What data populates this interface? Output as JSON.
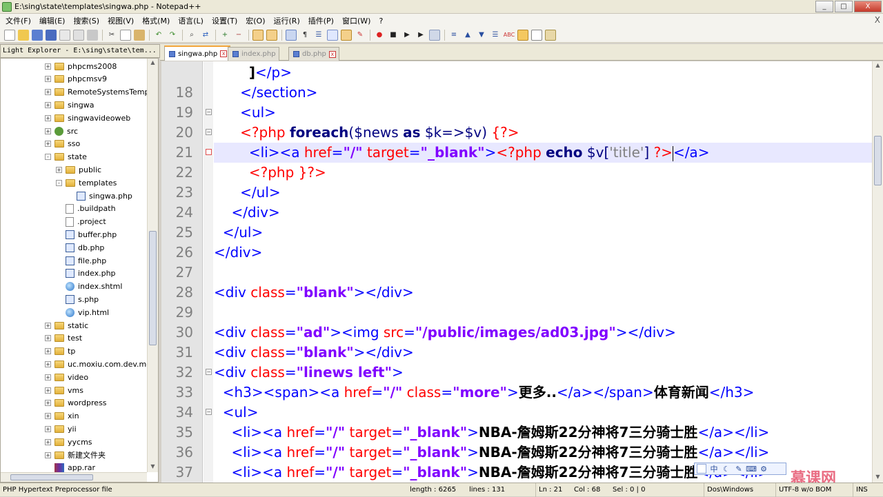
{
  "window": {
    "title": "E:\\sing\\state\\templates\\singwa.php - Notepad++",
    "btn_min": "_",
    "btn_max": "□",
    "btn_close": "X"
  },
  "menu": [
    "文件(F)",
    "编辑(E)",
    "搜索(S)",
    "视图(V)",
    "格式(M)",
    "语言(L)",
    "设置(T)",
    "宏(O)",
    "运行(R)",
    "插件(P)",
    "窗口(W)",
    "?"
  ],
  "menu_close": "X",
  "left_panel": {
    "title": "Light Explorer - E:\\sing\\state\\tem...",
    "tree": [
      {
        "label": "phpcms2008",
        "type": "folder",
        "indent": 0,
        "expander": "+"
      },
      {
        "label": "phpcmsv9",
        "type": "folder",
        "indent": 0,
        "expander": "+"
      },
      {
        "label": "RemoteSystemsTemp",
        "type": "folder",
        "indent": 0,
        "expander": "+"
      },
      {
        "label": "singwa",
        "type": "folder",
        "indent": 0,
        "expander": "+"
      },
      {
        "label": "singwavideoweb",
        "type": "folder",
        "indent": 0,
        "expander": "+"
      },
      {
        "label": "src",
        "type": "src",
        "indent": 0,
        "expander": "+"
      },
      {
        "label": "sso",
        "type": "folder",
        "indent": 0,
        "expander": "+"
      },
      {
        "label": "state",
        "type": "folder",
        "indent": 0,
        "expander": "-"
      },
      {
        "label": "public",
        "type": "folder",
        "indent": 1,
        "expander": "+"
      },
      {
        "label": "templates",
        "type": "folder",
        "indent": 1,
        "expander": "-"
      },
      {
        "label": "singwa.php",
        "type": "php",
        "indent": 2,
        "expander": ""
      },
      {
        "label": ".buildpath",
        "type": "file",
        "indent": 1,
        "expander": ""
      },
      {
        "label": ".project",
        "type": "file",
        "indent": 1,
        "expander": ""
      },
      {
        "label": "buffer.php",
        "type": "php",
        "indent": 1,
        "expander": ""
      },
      {
        "label": "db.php",
        "type": "php",
        "indent": 1,
        "expander": ""
      },
      {
        "label": "file.php",
        "type": "php",
        "indent": 1,
        "expander": ""
      },
      {
        "label": "index.php",
        "type": "php",
        "indent": 1,
        "expander": ""
      },
      {
        "label": "index.shtml",
        "type": "html",
        "indent": 1,
        "expander": ""
      },
      {
        "label": "s.php",
        "type": "php",
        "indent": 1,
        "expander": ""
      },
      {
        "label": "vip.html",
        "type": "html",
        "indent": 1,
        "expander": ""
      },
      {
        "label": "static",
        "type": "folder",
        "indent": 0,
        "expander": "+"
      },
      {
        "label": "test",
        "type": "folder",
        "indent": 0,
        "expander": "+"
      },
      {
        "label": "tp",
        "type": "folder",
        "indent": 0,
        "expander": "+"
      },
      {
        "label": "uc.moxiu.com.dev.mo",
        "type": "folder",
        "indent": 0,
        "expander": "+"
      },
      {
        "label": "video",
        "type": "folder",
        "indent": 0,
        "expander": "+"
      },
      {
        "label": "vms",
        "type": "folder",
        "indent": 0,
        "expander": "+"
      },
      {
        "label": "wordpress",
        "type": "folder",
        "indent": 0,
        "expander": "+"
      },
      {
        "label": "xin",
        "type": "folder",
        "indent": 0,
        "expander": "+"
      },
      {
        "label": "yii",
        "type": "folder",
        "indent": 0,
        "expander": "+"
      },
      {
        "label": "yycms",
        "type": "folder",
        "indent": 0,
        "expander": "+"
      },
      {
        "label": "新建文件夹",
        "type": "folder",
        "indent": 0,
        "expander": "+"
      },
      {
        "label": "app.rar",
        "type": "rar",
        "indent": 0,
        "expander": ""
      }
    ]
  },
  "tabs": [
    {
      "label": "singwa.php",
      "active": true
    },
    {
      "label": "index.php",
      "active": false
    },
    {
      "label": "db.php",
      "active": false
    }
  ],
  "editor": {
    "current_line": "21",
    "lines": [
      {
        "n": "",
        "fold": "",
        "tokens": [
          [
            "plain",
            "        "
          ],
          [
            "bold",
            "]"
          ],
          [
            "tag",
            "</p>"
          ]
        ]
      },
      {
        "n": "18",
        "fold": "",
        "tokens": [
          [
            "plain",
            "      "
          ],
          [
            "tag",
            "</section>"
          ]
        ]
      },
      {
        "n": "19",
        "fold": "-",
        "tokens": [
          [
            "plain",
            "      "
          ],
          [
            "tag",
            "<ul>"
          ]
        ]
      },
      {
        "n": "20",
        "fold": "-",
        "tokens": [
          [
            "plain",
            "      "
          ],
          [
            "php",
            "<?php "
          ],
          [
            "kw",
            "foreach"
          ],
          [
            "var",
            "($news "
          ],
          [
            "kw",
            "as"
          ],
          [
            "var",
            " $k=>$v) "
          ],
          [
            "php",
            "{?>"
          ]
        ]
      },
      {
        "n": "21",
        "fold": "r",
        "tokens": [
          [
            "plain",
            "        "
          ],
          [
            "tag",
            "<li><a "
          ],
          [
            "attr",
            "href"
          ],
          [
            "tag",
            "="
          ],
          [
            "str",
            "\"/\""
          ],
          [
            "attr",
            " target"
          ],
          [
            "tag",
            "="
          ],
          [
            "str",
            "\"_blank\""
          ],
          [
            "tag",
            ">"
          ],
          [
            "php",
            "<?php "
          ],
          [
            "kw",
            "echo"
          ],
          [
            "var",
            " $v["
          ],
          [
            "gray",
            "'title'"
          ],
          [
            "var",
            "] "
          ],
          [
            "php",
            "?>"
          ],
          [
            "caret",
            ""
          ],
          [
            "tag",
            "</a>"
          ]
        ]
      },
      {
        "n": "22",
        "fold": "",
        "tokens": [
          [
            "plain",
            "        "
          ],
          [
            "php",
            "<?php }?>"
          ]
        ]
      },
      {
        "n": "23",
        "fold": "",
        "tokens": [
          [
            "plain",
            "      "
          ],
          [
            "tag",
            "</ul>"
          ]
        ]
      },
      {
        "n": "24",
        "fold": "",
        "tokens": [
          [
            "plain",
            "    "
          ],
          [
            "tag",
            "</div>"
          ]
        ]
      },
      {
        "n": "25",
        "fold": "",
        "tokens": [
          [
            "plain",
            "  "
          ],
          [
            "tag",
            "</ul>"
          ]
        ]
      },
      {
        "n": "26",
        "fold": "",
        "tokens": [
          [
            "tag",
            "</div>"
          ]
        ]
      },
      {
        "n": "27",
        "fold": "",
        "tokens": []
      },
      {
        "n": "28",
        "fold": "",
        "tokens": [
          [
            "tag",
            "<div "
          ],
          [
            "attr",
            "class"
          ],
          [
            "tag",
            "="
          ],
          [
            "str",
            "\"blank\""
          ],
          [
            "tag",
            "></div>"
          ]
        ]
      },
      {
        "n": "29",
        "fold": "",
        "tokens": []
      },
      {
        "n": "30",
        "fold": "",
        "tokens": [
          [
            "tag",
            "<div "
          ],
          [
            "attr",
            "class"
          ],
          [
            "tag",
            "="
          ],
          [
            "str",
            "\"ad\""
          ],
          [
            "tag",
            "><img "
          ],
          [
            "attr",
            "src"
          ],
          [
            "tag",
            "="
          ],
          [
            "str",
            "\"/public/images/ad03.jpg\""
          ],
          [
            "tag",
            "></div>"
          ]
        ]
      },
      {
        "n": "31",
        "fold": "",
        "tokens": [
          [
            "tag",
            "<div "
          ],
          [
            "attr",
            "class"
          ],
          [
            "tag",
            "="
          ],
          [
            "str",
            "\"blank\""
          ],
          [
            "tag",
            "></div>"
          ]
        ]
      },
      {
        "n": "32",
        "fold": "-",
        "tokens": [
          [
            "tag",
            "<div "
          ],
          [
            "attr",
            "class"
          ],
          [
            "tag",
            "="
          ],
          [
            "str",
            "\"linews left\""
          ],
          [
            "tag",
            ">"
          ]
        ]
      },
      {
        "n": "33",
        "fold": "",
        "tokens": [
          [
            "plain",
            "  "
          ],
          [
            "tag",
            "<h3><span><a "
          ],
          [
            "attr",
            "href"
          ],
          [
            "tag",
            "="
          ],
          [
            "str",
            "\"/\""
          ],
          [
            "attr",
            " class"
          ],
          [
            "tag",
            "="
          ],
          [
            "str",
            "\"more\""
          ],
          [
            "tag",
            ">"
          ],
          [
            "bold",
            "更多.."
          ],
          [
            "tag",
            "</a></span>"
          ],
          [
            "bold",
            "体育新闻"
          ],
          [
            "tag",
            "</h3>"
          ]
        ]
      },
      {
        "n": "34",
        "fold": "-",
        "tokens": [
          [
            "plain",
            "  "
          ],
          [
            "tag",
            "<ul>"
          ]
        ]
      },
      {
        "n": "35",
        "fold": "",
        "tokens": [
          [
            "plain",
            "    "
          ],
          [
            "tag",
            "<li><a "
          ],
          [
            "attr",
            "href"
          ],
          [
            "tag",
            "="
          ],
          [
            "str",
            "\"/\""
          ],
          [
            "attr",
            " target"
          ],
          [
            "tag",
            "="
          ],
          [
            "str",
            "\"_blank\""
          ],
          [
            "tag",
            ">"
          ],
          [
            "bold",
            "NBA-詹姆斯22分神将7三分骑士胜"
          ],
          [
            "tag",
            "</a></li>"
          ]
        ]
      },
      {
        "n": "36",
        "fold": "",
        "tokens": [
          [
            "plain",
            "    "
          ],
          [
            "tag",
            "<li><a "
          ],
          [
            "attr",
            "href"
          ],
          [
            "tag",
            "="
          ],
          [
            "str",
            "\"/\""
          ],
          [
            "attr",
            " target"
          ],
          [
            "tag",
            "="
          ],
          [
            "str",
            "\"_blank\""
          ],
          [
            "tag",
            ">"
          ],
          [
            "bold",
            "NBA-詹姆斯22分神将7三分骑士胜"
          ],
          [
            "tag",
            "</a></li>"
          ]
        ]
      },
      {
        "n": "37",
        "fold": "",
        "tokens": [
          [
            "plain",
            "    "
          ],
          [
            "tag",
            "<li><a "
          ],
          [
            "attr",
            "href"
          ],
          [
            "tag",
            "="
          ],
          [
            "str",
            "\"/\""
          ],
          [
            "attr",
            " target"
          ],
          [
            "tag",
            "="
          ],
          [
            "str",
            "\"_blank\""
          ],
          [
            "tag",
            ">"
          ],
          [
            "bold",
            "NBA-詹姆斯22分神将7三分骑士胜"
          ],
          [
            "tag",
            "</a></li>"
          ]
        ]
      }
    ]
  },
  "ime_bar": [
    "中",
    "☾",
    "✎",
    "⌨",
    "⚙"
  ],
  "watermark": "慕课网",
  "statusbar": {
    "file_type": "PHP Hypertext Preprocessor file",
    "length": "length : 6265",
    "lines": "lines : 131",
    "ln": "Ln : 21",
    "col": "Col : 68",
    "sel": "Sel : 0 | 0",
    "eol": "Dos\\Windows",
    "encoding": "UTF-8 w/o BOM",
    "mode": "INS"
  },
  "colors": {
    "tag": "#0000ff",
    "attr": "#ff0000",
    "string": "#8000ff",
    "php_delim": "#ff0000",
    "keyword": "#000080",
    "current_line_bg": "#e8e8ff"
  }
}
